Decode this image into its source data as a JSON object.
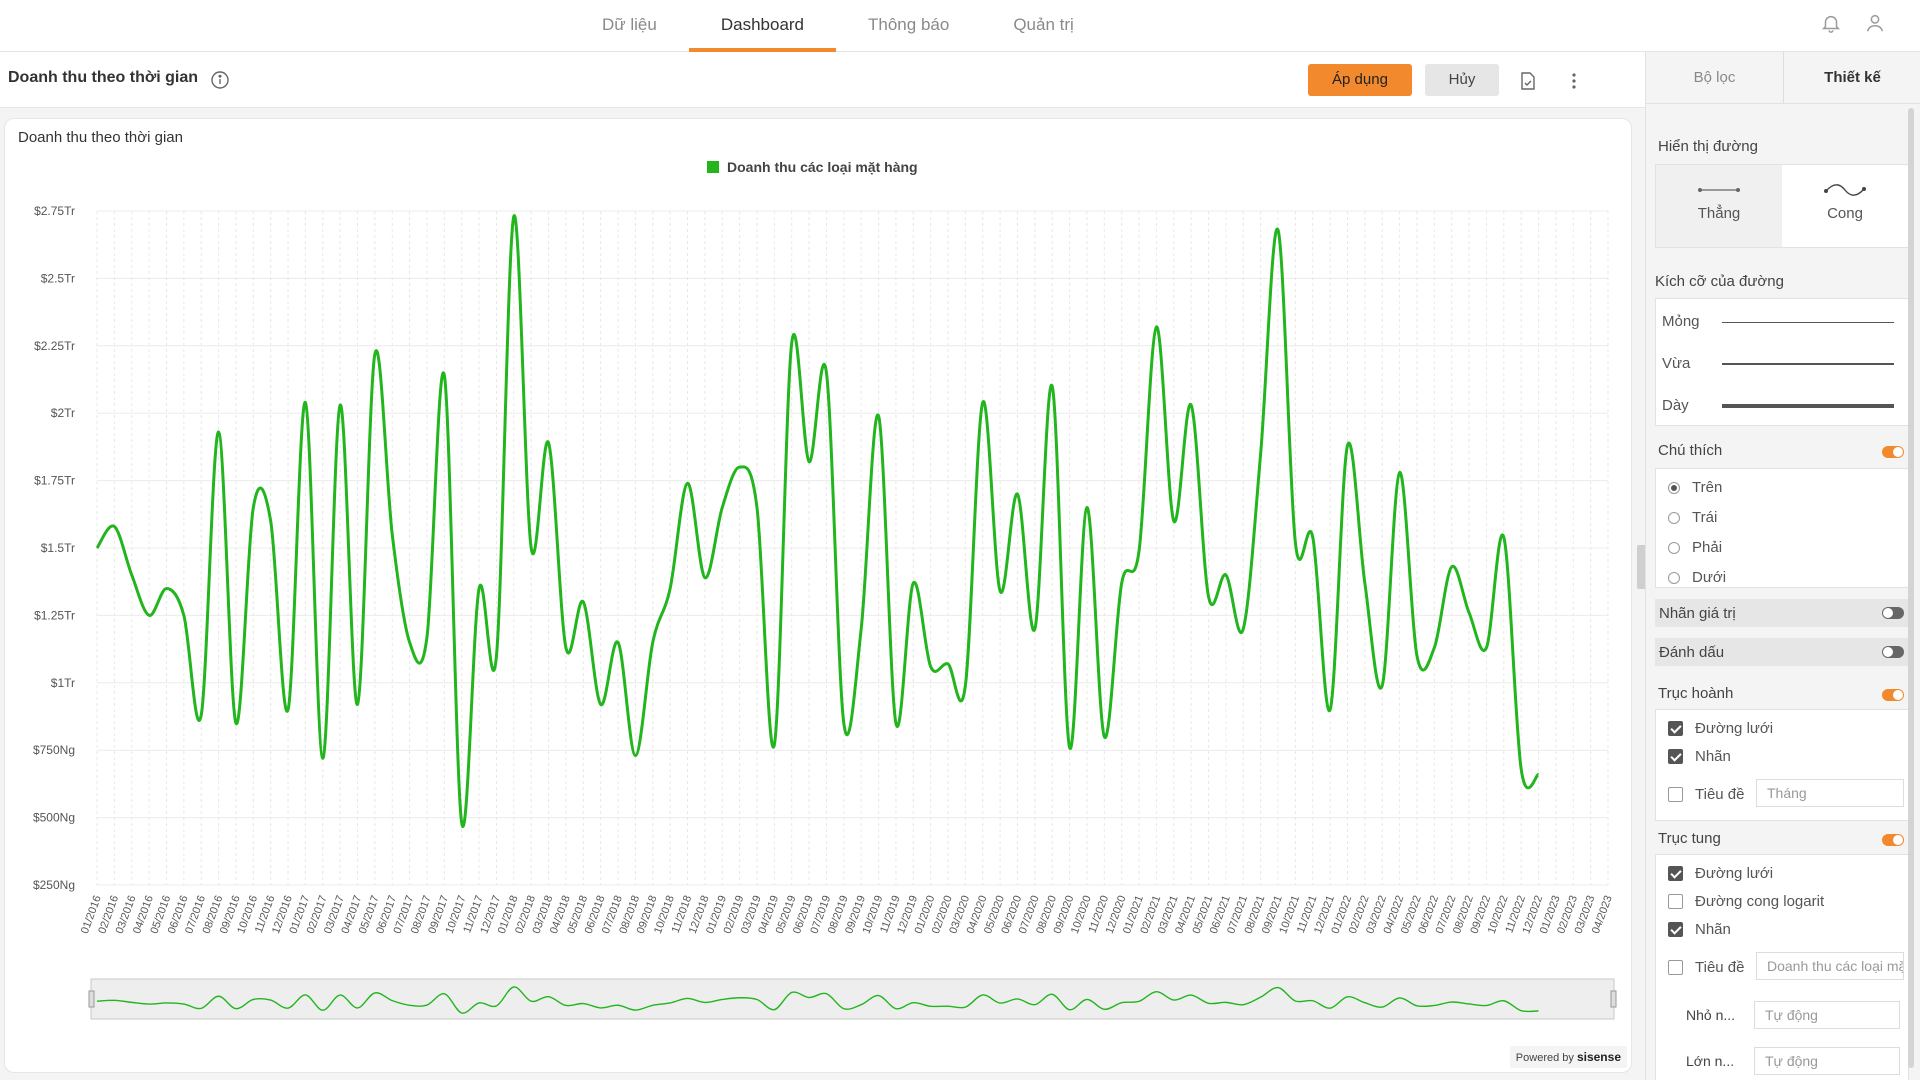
{
  "nav": {
    "tabs": [
      {
        "label": "Dữ liệu"
      },
      {
        "label": "Dashboard",
        "active": true
      },
      {
        "label": "Thông báo"
      },
      {
        "label": "Quản trị"
      }
    ],
    "icons": [
      "bell-icon",
      "user-icon"
    ]
  },
  "toolbar": {
    "title": "Doanh thu theo thời gian",
    "apply_label": "Áp dụng",
    "cancel_label": "Hủy",
    "icons": [
      "info-icon",
      "export-icon",
      "more-icon"
    ]
  },
  "widget": {
    "title": "Doanh thu theo thời gian",
    "powered_by": "Powered by",
    "brand": "sisense"
  },
  "colors": {
    "accent": "#f2892d",
    "series": "#22b51e"
  },
  "chart_data": {
    "type": "line",
    "curve": "smooth",
    "legend": "top",
    "grid": true,
    "ylim": [
      250,
      2750
    ],
    "yticks": [
      250,
      500,
      750,
      1000,
      1250,
      1500,
      1750,
      2000,
      2250,
      2500,
      2750
    ],
    "ytick_labels": [
      "$250Ng",
      "$500Ng",
      "$750Ng",
      "$1Tr",
      "$1.25Tr",
      "$1.5Tr",
      "$1.75Tr",
      "$2Tr",
      "$2.25Tr",
      "$2.5Tr",
      "$2.75Tr"
    ],
    "x": [
      "01/2016",
      "02/2016",
      "03/2016",
      "04/2016",
      "05/2016",
      "06/2016",
      "07/2016",
      "08/2016",
      "09/2016",
      "10/2016",
      "11/2016",
      "12/2016",
      "01/2017",
      "02/2017",
      "03/2017",
      "04/2017",
      "05/2017",
      "06/2017",
      "07/2017",
      "08/2017",
      "09/2017",
      "10/2017",
      "11/2017",
      "12/2017",
      "01/2018",
      "02/2018",
      "03/2018",
      "04/2018",
      "05/2018",
      "06/2018",
      "07/2018",
      "08/2018",
      "09/2018",
      "10/2018",
      "11/2018",
      "12/2018",
      "01/2019",
      "02/2019",
      "03/2019",
      "04/2019",
      "05/2019",
      "06/2019",
      "07/2019",
      "08/2019",
      "09/2019",
      "10/2019",
      "11/2019",
      "12/2019",
      "01/2020",
      "02/2020",
      "03/2020",
      "04/2020",
      "05/2020",
      "06/2020",
      "07/2020",
      "08/2020",
      "09/2020",
      "10/2020",
      "11/2020",
      "12/2020",
      "01/2021",
      "02/2021",
      "03/2021",
      "04/2021",
      "05/2021",
      "06/2021",
      "07/2021",
      "08/2021",
      "09/2021",
      "10/2021",
      "11/2021",
      "12/2021",
      "01/2022",
      "02/2022",
      "03/2022",
      "04/2022",
      "05/2022",
      "06/2022",
      "07/2022",
      "08/2022",
      "09/2022",
      "10/2022",
      "11/2022",
      "12/2022",
      "01/2023",
      "02/2023",
      "03/2023",
      "04/2023"
    ],
    "series": [
      {
        "name": "Doanh thu các loại mặt hàng",
        "values": [
          1500,
          1580,
          1400,
          1250,
          1350,
          1250,
          880,
          1930,
          850,
          1650,
          1600,
          900,
          2040,
          720,
          2030,
          920,
          2220,
          1550,
          1150,
          1170,
          2140,
          480,
          1350,
          1100,
          2730,
          1500,
          1890,
          1130,
          1300,
          920,
          1150,
          730,
          1150,
          1350,
          1740,
          1390,
          1650,
          1800,
          1650,
          770,
          2260,
          1820,
          2150,
          850,
          1200,
          1990,
          850,
          1370,
          1060,
          1070,
          990,
          2040,
          1340,
          1700,
          1200,
          2100,
          760,
          1650,
          800,
          1370,
          1490,
          2320,
          1600,
          2030,
          1320,
          1400,
          1200,
          1850,
          2680,
          1520,
          1540,
          900,
          1880,
          1370,
          990,
          1780,
          1100,
          1130,
          1430,
          1260,
          1130,
          1540,
          680,
          660
        ]
      }
    ]
  },
  "panel": {
    "tabs": [
      {
        "label": "Bộ lọc"
      },
      {
        "label": "Thiết kế",
        "active": true
      }
    ],
    "line_display": {
      "label": "Hiển thị đường",
      "options": [
        {
          "label": "Thẳng",
          "selected": true
        },
        {
          "label": "Cong"
        }
      ]
    },
    "line_size": {
      "label": "Kích cỡ của đường",
      "options": [
        {
          "label": "Mỏng"
        },
        {
          "label": "Vừa"
        },
        {
          "label": "Dày"
        }
      ]
    },
    "legend": {
      "label": "Chú thích",
      "enabled": true,
      "positions": [
        {
          "label": "Trên",
          "checked": true
        },
        {
          "label": "Trái"
        },
        {
          "label": "Phải"
        },
        {
          "label": "Dưới"
        }
      ]
    },
    "value_labels": {
      "label": "Nhãn giá trị",
      "enabled": false
    },
    "markers": {
      "label": "Đánh dấu",
      "enabled": false
    },
    "x_axis": {
      "label": "Trục hoành",
      "enabled": true,
      "gridlines": {
        "label": "Đường lưới",
        "checked": true
      },
      "labels": {
        "label": "Nhãn",
        "checked": true
      },
      "title": {
        "label": "Tiêu đề",
        "checked": false,
        "placeholder": "Tháng"
      }
    },
    "y_axis": {
      "label": "Trục tung",
      "enabled": true,
      "gridlines": {
        "label": "Đường lưới",
        "checked": true
      },
      "log": {
        "label": "Đường cong logarit",
        "checked": false
      },
      "labels": {
        "label": "Nhãn",
        "checked": true
      },
      "title": {
        "label": "Tiêu đề",
        "checked": false,
        "placeholder": "Doanh thu các loại mặt hàng"
      },
      "min": {
        "label": "Nhỏ n...",
        "placeholder": "Tự động"
      },
      "max": {
        "label": "Lớn n...",
        "placeholder": "Tự động"
      }
    }
  }
}
